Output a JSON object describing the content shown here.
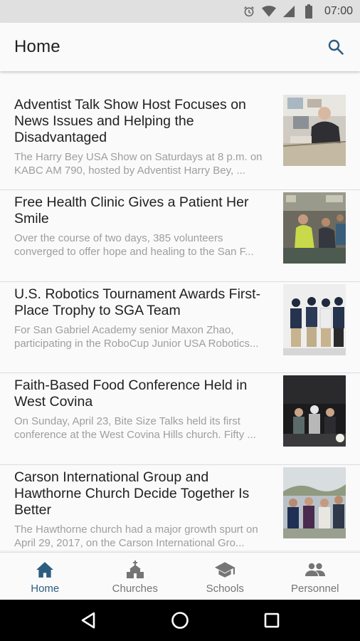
{
  "status_bar": {
    "time": "07:00",
    "icons": [
      "alarm-icon",
      "wifi-icon",
      "signal-icon",
      "battery-icon"
    ]
  },
  "app_bar": {
    "title": "Home",
    "action_icon": "search-icon"
  },
  "articles": [
    {
      "headline": "Adventist Talk Show Host Focuses on News Issues and Helping the Disadvantaged",
      "summary": "The Harry Bey USA Show on Saturdays at 8 p.m. on KABC AM 790, hosted by Adventist Harry Bey, ..."
    },
    {
      "headline": "Free Health Clinic Gives a Patient Her Smile",
      "summary": "Over the course of two days, 385 volunteers converged to offer hope and healing to the San F..."
    },
    {
      "headline": "U.S. Robotics Tournament Awards First-Place Trophy to SGA Team",
      "summary": "For San Gabriel Academy senior Maxon Zhao, participating in the RoboCup Junior USA Robotics..."
    },
    {
      "headline": "Faith-Based Food Conference Held in West Covina",
      "summary": "On Sunday, April 23, Bite Size Talks held its first conference at the West Covina Hills church. Fifty ..."
    },
    {
      "headline": "Carson International Group and Hawthorne Church Decide Together Is Better",
      "summary": "The Hawthorne church had a major growth spurt on April 29, 2017, on the Carson International Gro..."
    }
  ],
  "bottom_nav": {
    "active_color": "#2b5d80",
    "inactive_color": "#757575",
    "items": [
      {
        "label": "Home",
        "icon": "home-icon",
        "active": true
      },
      {
        "label": "Churches",
        "icon": "church-icon",
        "active": false
      },
      {
        "label": "Schools",
        "icon": "school-icon",
        "active": false
      },
      {
        "label": "Personnel",
        "icon": "people-icon",
        "active": false
      }
    ]
  },
  "system_nav": {
    "icons": [
      "back-icon",
      "home-circle-icon",
      "recents-icon"
    ]
  }
}
